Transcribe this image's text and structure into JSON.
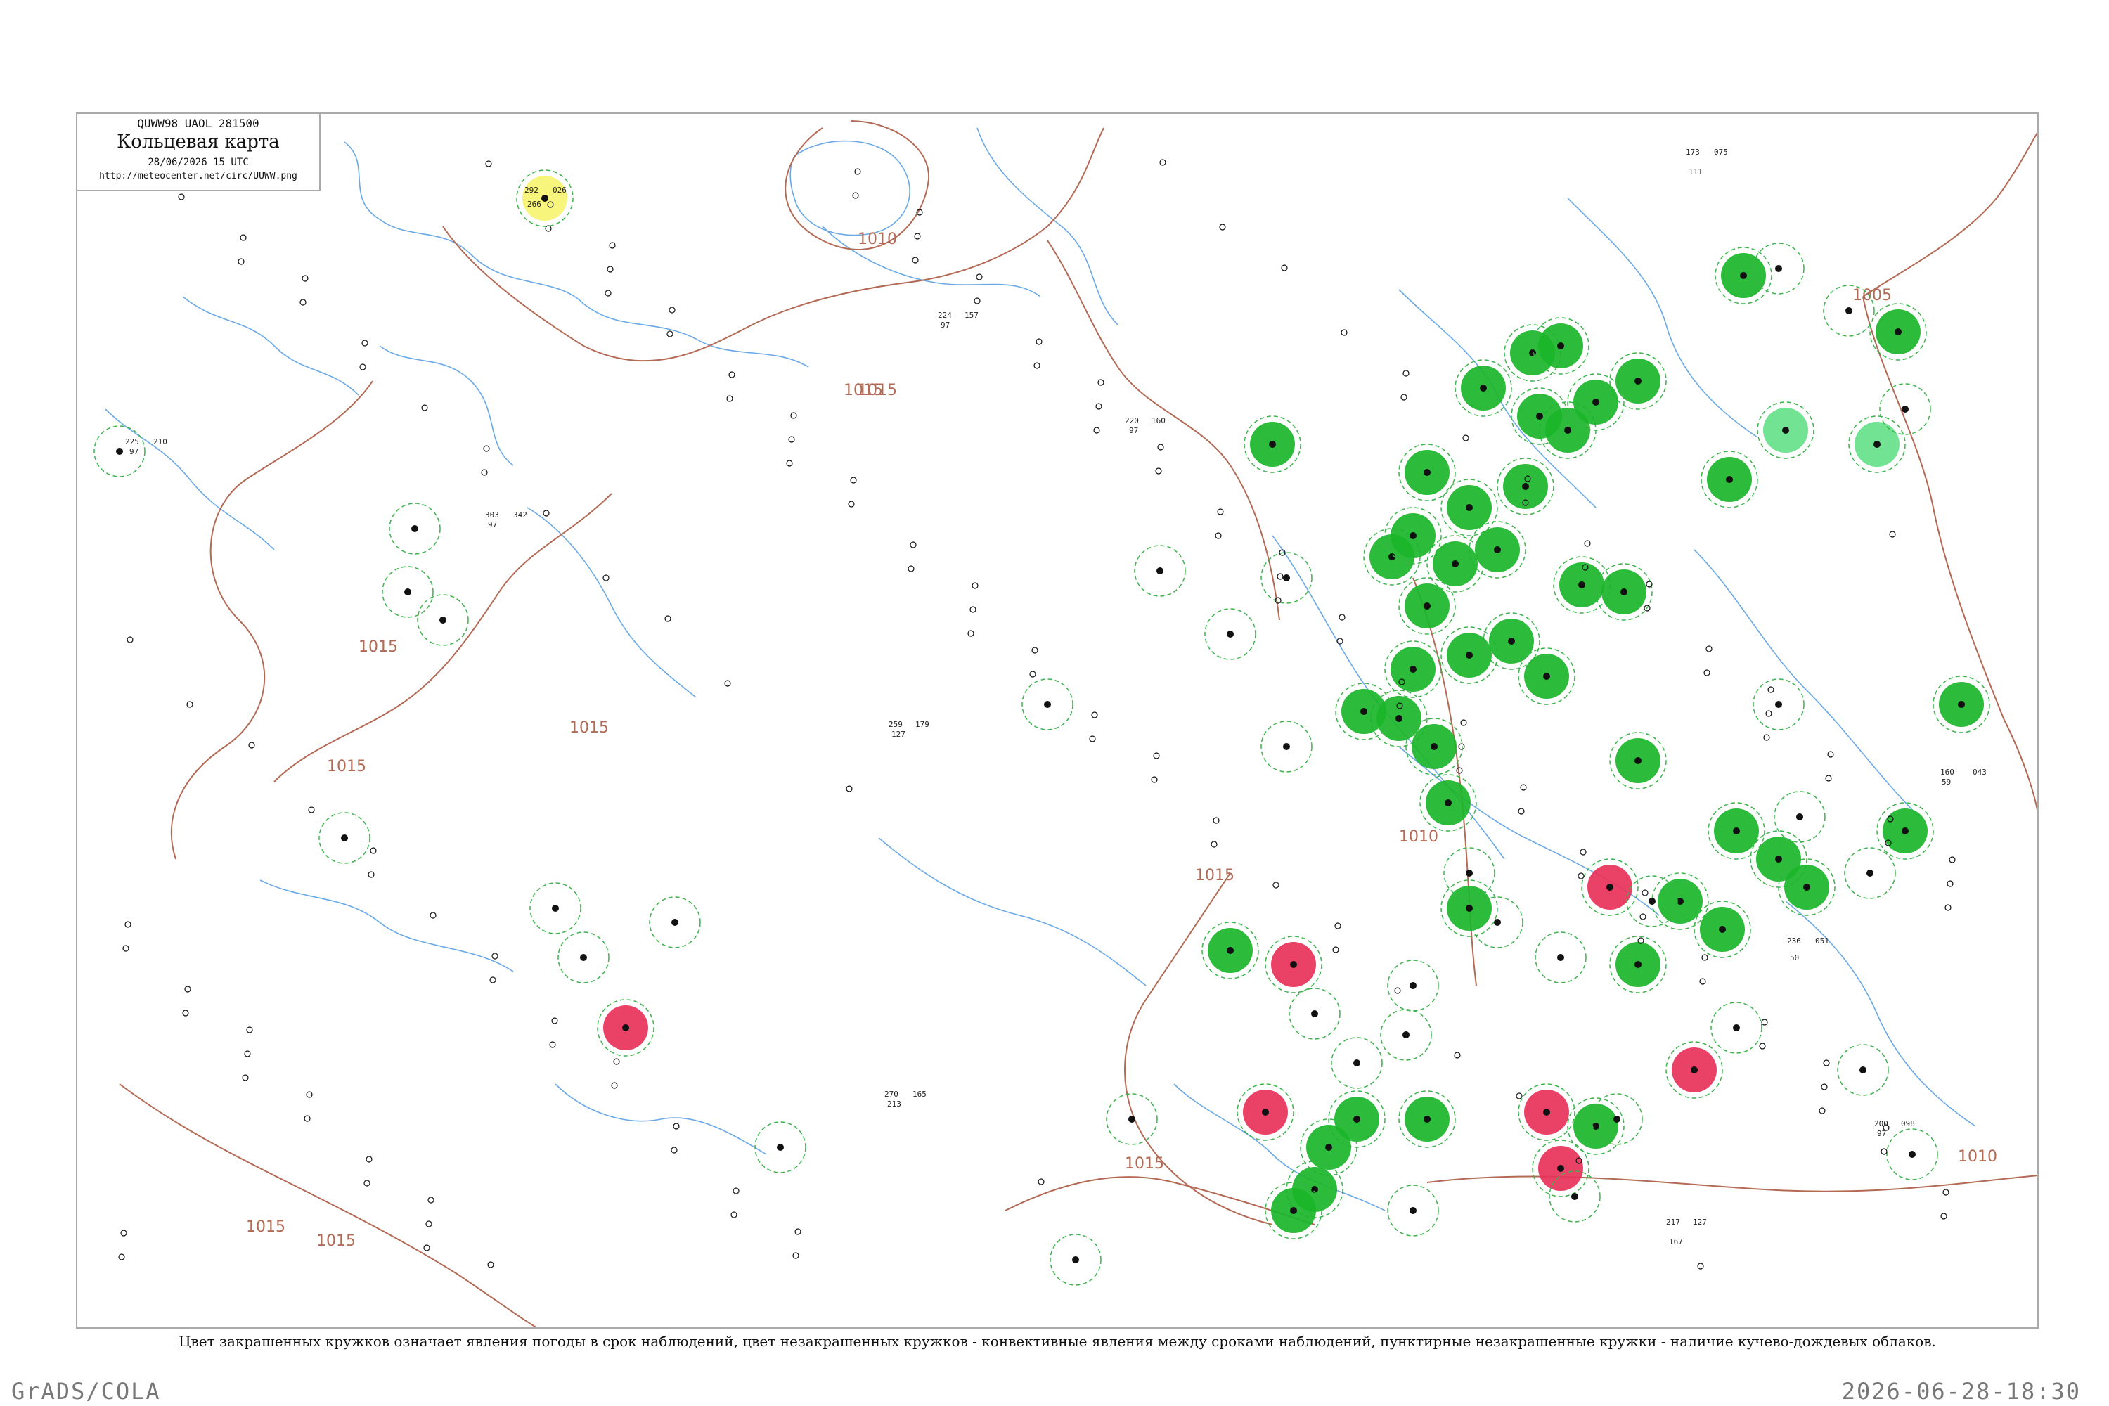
{
  "header": {
    "bulletin": "QUWW98  UAOL  281500",
    "title": "Кольцевая карта",
    "date": "28/06/2026 15 UTC",
    "url": "http://meteocenter.net/circ/UUWW.png"
  },
  "caption": "Цвет закрашенных кружков означает явления погоды в срок наблюдений, цвет незакрашенных кружков - конвективные явления между сроками наблюдений, пунктирные незакрашенные кружки - наличие кучево-дождевых облаков.",
  "footer": {
    "left": "GrADS/COLA",
    "right": "2026-06-28-18:30"
  },
  "colors": {
    "isobar": "#b36a55",
    "water": "#6aa9e6",
    "border": "#aaaaaa",
    "shower_green": "#1bb52a",
    "thunder_red": "#e8325a",
    "light_green": "#66e08a",
    "yellow": "#f5f25a",
    "cb_dashed": "#3cb44b"
  },
  "isobar_labels": [
    "1010",
    "1015",
    "1015",
    "1015",
    "1015",
    "1015",
    "1015",
    "1005",
    "1010",
    "1010",
    "1015",
    "1015",
    "1015"
  ],
  "station_samples": [
    {
      "left": "292",
      "right": "026",
      "bottom": "266"
    },
    {
      "left": "225",
      "right": "210",
      "bottom": "97"
    },
    {
      "left": "224",
      "right": "157",
      "bottom": "97"
    },
    {
      "left": "220",
      "right": "160",
      "bottom": "97"
    },
    {
      "left": "303",
      "right": "342",
      "bottom": "97"
    },
    {
      "left": "259",
      "right": "179",
      "bottom": "127"
    },
    {
      "left": "270",
      "right": "165",
      "bottom": "213"
    },
    {
      "left": "173",
      "right": "075",
      "bottom": "111"
    },
    {
      "left": "200",
      "right": "098",
      "bottom": "97"
    },
    {
      "left": "217",
      "right": "127",
      "bottom": "167"
    },
    {
      "left": "236",
      "right": "051",
      "bottom": "50"
    },
    {
      "left": "160",
      "right": "043",
      "bottom": "59"
    }
  ]
}
